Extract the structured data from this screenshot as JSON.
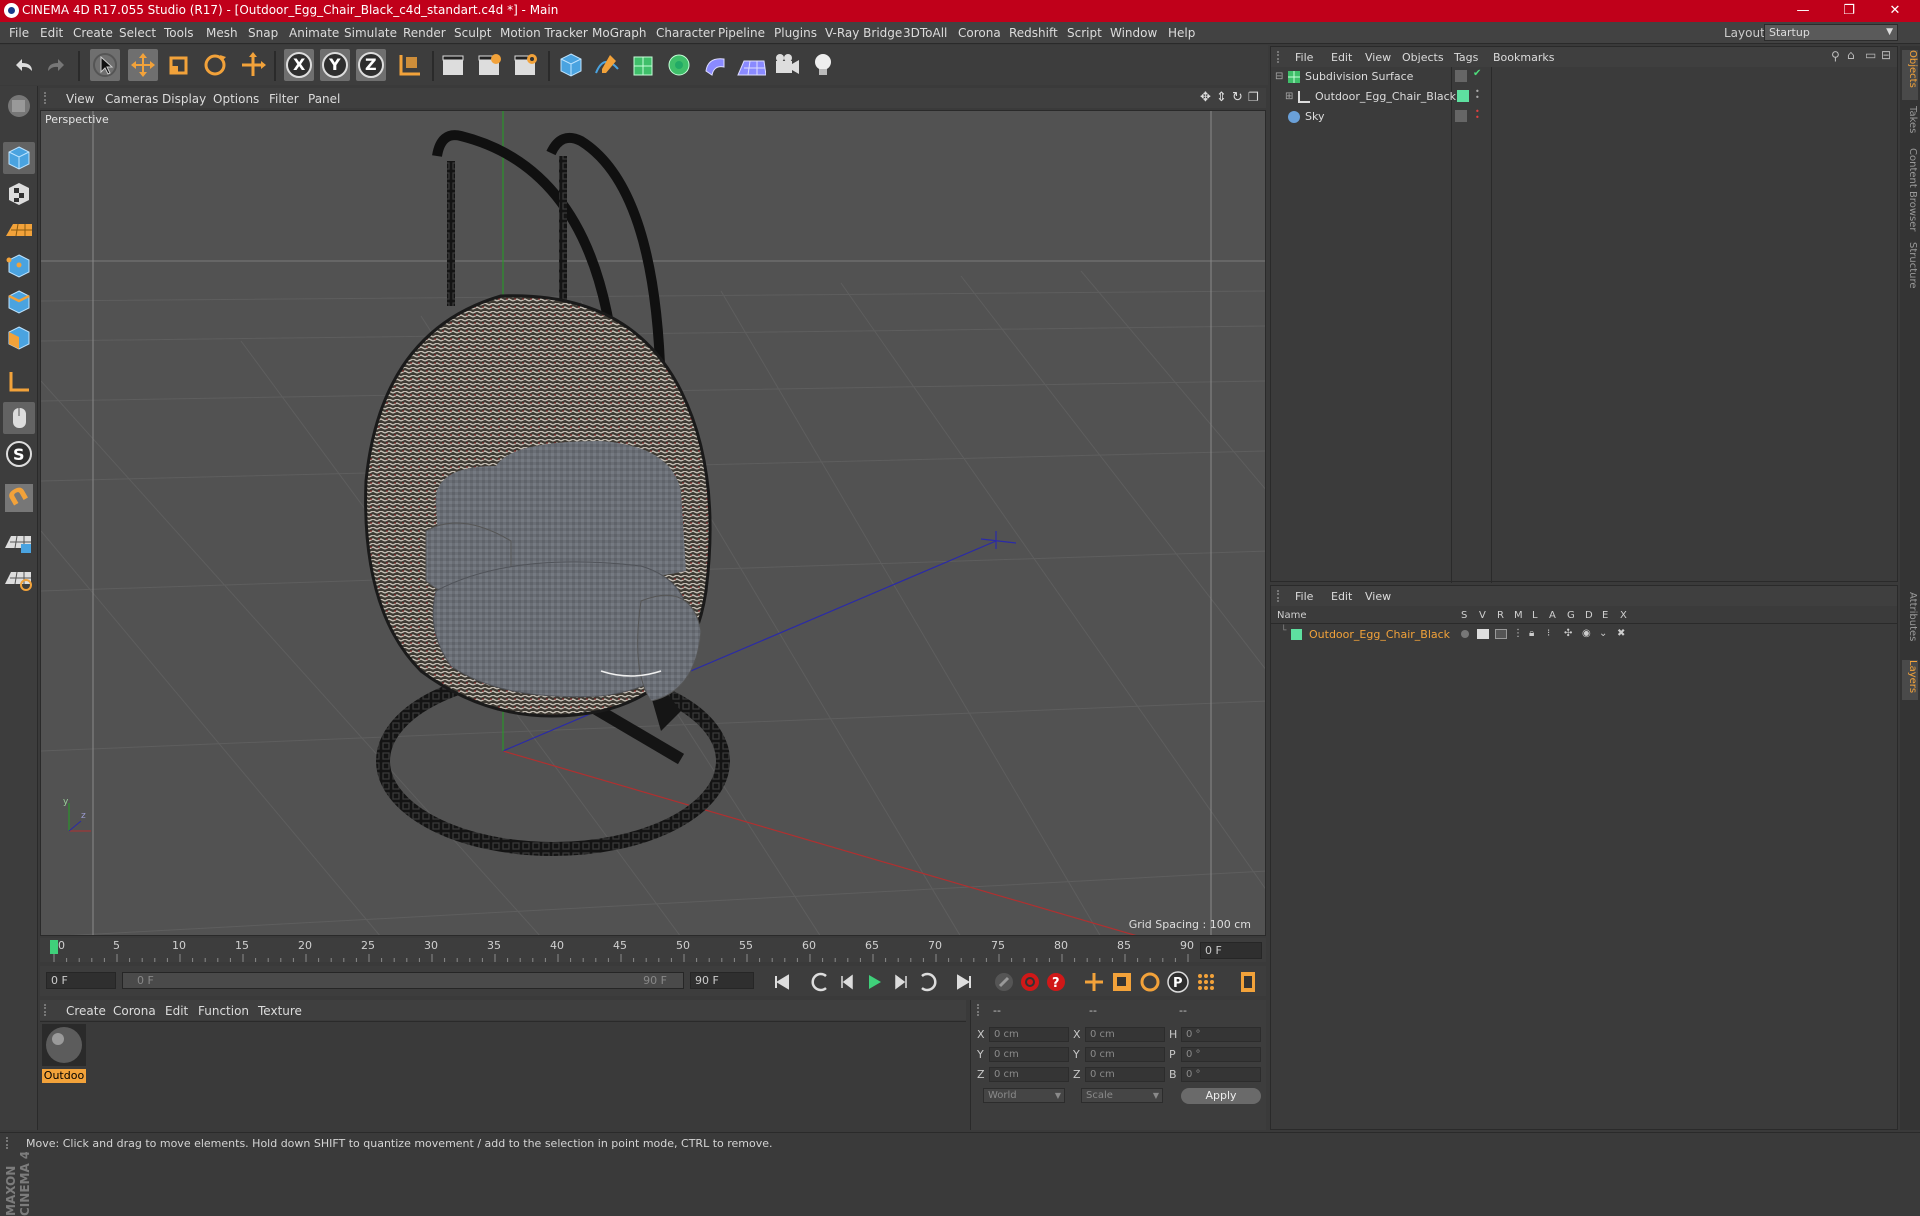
{
  "window": {
    "title": "CINEMA 4D R17.055 Studio (R17) - [Outdoor_Egg_Chair_Black_c4d_standart.c4d *] - Main",
    "minimize": "—",
    "maximize": "❐",
    "close": "✕"
  },
  "menubar": {
    "items": [
      "File",
      "Edit",
      "Create",
      "Select",
      "Tools",
      "Mesh",
      "Snap",
      "Animate",
      "Simulate",
      "Render",
      "Sculpt",
      "Motion Tracker",
      "MoGraph",
      "Character",
      "Pipeline",
      "Plugins",
      "V-Ray Bridge",
      "3DToAll",
      "Corona",
      "Redshift",
      "Script",
      "Window",
      "Help"
    ],
    "layout_label": "Layout:",
    "layout_value": "Startup"
  },
  "toolbar": {
    "axis_x": "X",
    "axis_y": "Y",
    "axis_z": "Z"
  },
  "viewport": {
    "menu": [
      "View",
      "Cameras",
      "Display",
      "Options",
      "Filter",
      "Panel"
    ],
    "label": "Perspective",
    "grid_spacing": "Grid Spacing : 100 cm",
    "axis_y": "y",
    "axis_z": "z"
  },
  "timeline": {
    "ticks": [
      "0",
      "5",
      "10",
      "15",
      "20",
      "25",
      "30",
      "35",
      "40",
      "45",
      "50",
      "55",
      "60",
      "65",
      "70",
      "75",
      "80",
      "85",
      "90"
    ],
    "current_frame": "0 F",
    "start_field": "0 F",
    "range_start": "0 F",
    "range_end": "90 F",
    "end_field": "90 F"
  },
  "material_panel": {
    "menu": [
      "Create",
      "Corona",
      "Edit",
      "Function",
      "Texture"
    ],
    "material_name": "Outdoo"
  },
  "coords": {
    "headers": [
      "--",
      "--",
      "--"
    ],
    "rows": [
      {
        "a": "X",
        "av": "0 cm",
        "b": "X",
        "bv": "0 cm",
        "c": "H",
        "cv": "0 °"
      },
      {
        "a": "Y",
        "av": "0 cm",
        "b": "Y",
        "bv": "0 cm",
        "c": "P",
        "cv": "0 °"
      },
      {
        "a": "Z",
        "av": "0 cm",
        "b": "Z",
        "bv": "0 cm",
        "c": "B",
        "cv": "0 °"
      }
    ],
    "mode_world": "World",
    "mode_scale": "Scale",
    "apply": "Apply"
  },
  "objects_panel": {
    "menu": [
      "File",
      "Edit",
      "View",
      "Objects",
      "Tags",
      "Bookmarks"
    ],
    "items": [
      {
        "name": "Subdivision Surface"
      },
      {
        "name": "Outdoor_Egg_Chair_Black"
      },
      {
        "name": "Sky"
      }
    ]
  },
  "layers_panel": {
    "menu": [
      "File",
      "Edit",
      "View"
    ],
    "col_name": "Name",
    "cols": [
      "S",
      "V",
      "R",
      "M",
      "L",
      "A",
      "G",
      "D",
      "E",
      "X"
    ],
    "layer_name": "Outdoor_Egg_Chair_Black"
  },
  "right_tabs": [
    "Objects",
    "Takes",
    "Content Browser",
    "Structure",
    "Attributes",
    "Layers"
  ],
  "status": {
    "text": "Move: Click and drag to move elements. Hold down SHIFT to quantize movement / add to the selection in point mode, CTRL to remove."
  },
  "logo": {
    "text": "MAXON CINEMA 4D"
  },
  "colors": {
    "title_bar": "#c0001a",
    "accent_orange": "#f2a23a",
    "layer_green": "#5ee0a0"
  }
}
